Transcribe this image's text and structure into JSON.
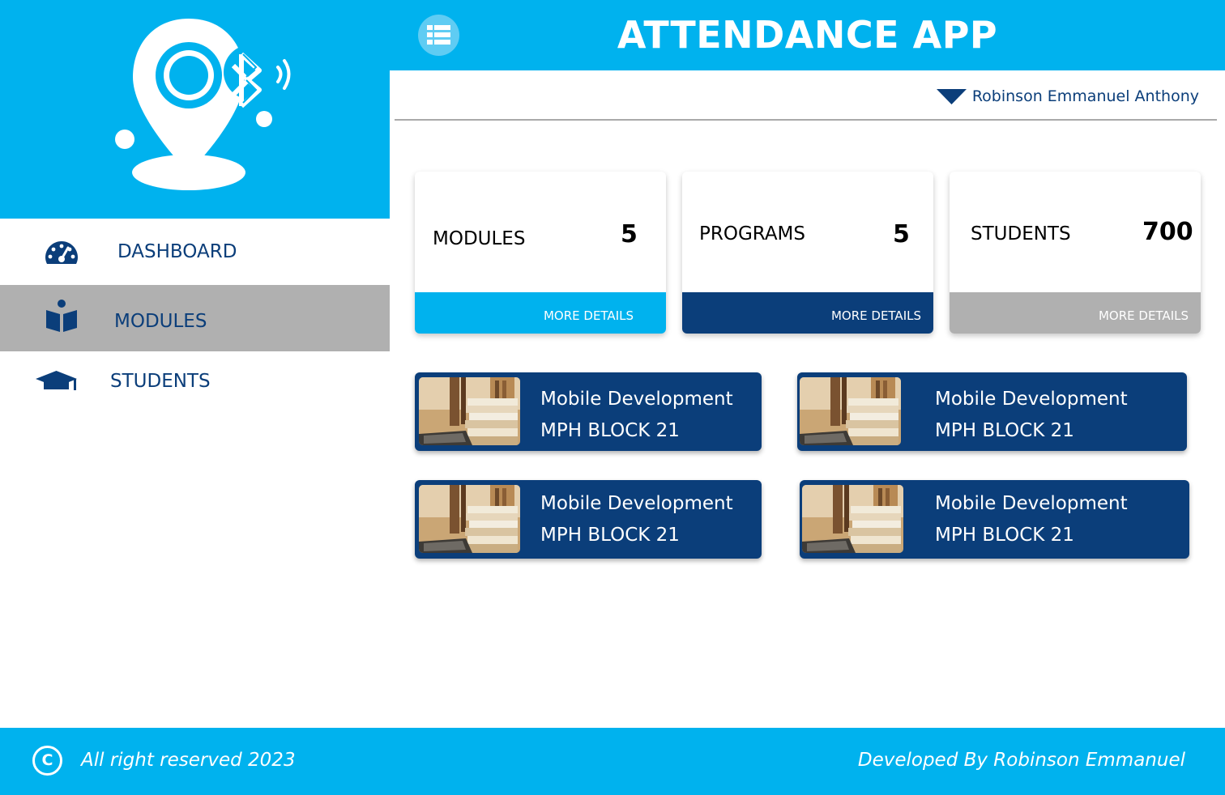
{
  "header": {
    "title": "ATTENDANCE APP",
    "menu_icon": "list-menu-icon"
  },
  "logo": {
    "icon": "location-bluetooth-logo"
  },
  "user": {
    "name": "Robinson Emmanuel Anthony",
    "dropdown_icon": "triangle-down-icon"
  },
  "sidebar": {
    "items": [
      {
        "label": "DASHBOARD",
        "icon": "speedometer-icon",
        "active": false
      },
      {
        "label": "MODULES",
        "icon": "book-reader-icon",
        "active": true
      },
      {
        "label": "STUDENTS",
        "icon": "graduation-cap-icon",
        "active": false
      }
    ]
  },
  "stats": [
    {
      "label": "MODULES",
      "value": "5",
      "action": "MORE DETAILS",
      "color": "#00b2ee"
    },
    {
      "label": "PROGRAMS",
      "value": "5",
      "action": "MORE DETAILS",
      "color": "#0b3e7a"
    },
    {
      "label": "STUDENTS",
      "value": "700",
      "action": "MORE DETAILS",
      "color": "#b0b0b0"
    }
  ],
  "modules": [
    {
      "title": "Mobile Development",
      "location": "MPH BLOCK 21"
    },
    {
      "title": "Mobile Development",
      "location": "MPH BLOCK 21"
    },
    {
      "title": "Mobile Development",
      "location": "MPH BLOCK 21"
    },
    {
      "title": "Mobile Development",
      "location": "MPH BLOCK 21"
    }
  ],
  "footer": {
    "copyright": "All right reserved 2023",
    "developer": "Developed By Robinson Emmanuel",
    "copyright_symbol": "C"
  },
  "colors": {
    "primary": "#00b2ee",
    "navy": "#0b3e7a",
    "gray": "#b0b0b0"
  }
}
